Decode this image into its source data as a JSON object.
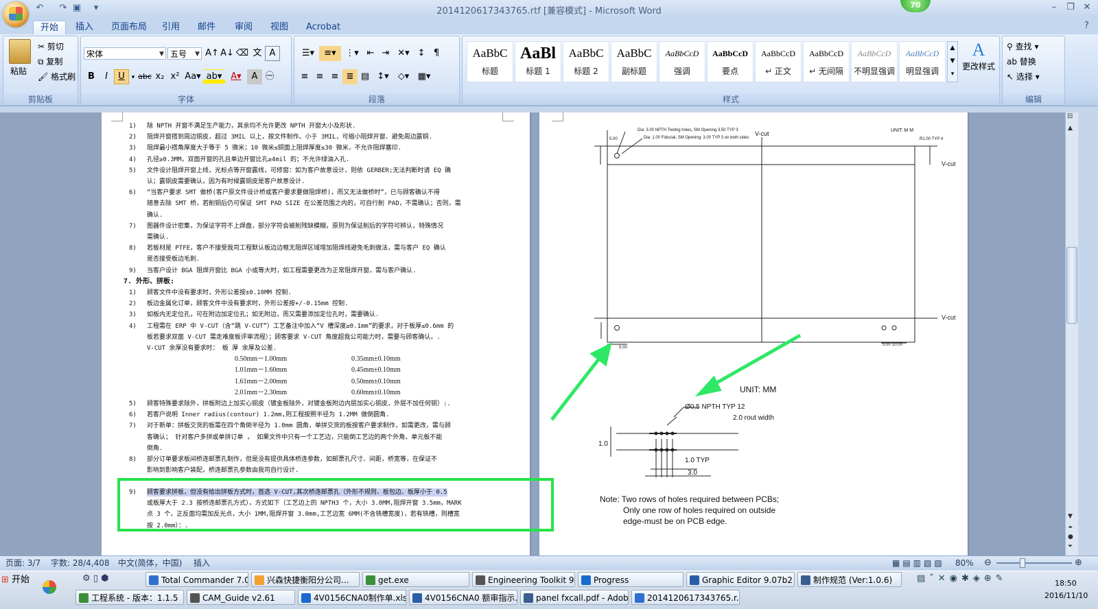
{
  "window": {
    "title": "2014120617343765.rtf [兼容模式] - Microsoft Word",
    "badge": "70"
  },
  "tabs": [
    "开始",
    "插入",
    "页面布局",
    "引用",
    "邮件",
    "审阅",
    "视图",
    "Acrobat"
  ],
  "ribbon": {
    "clipboard": {
      "label": "剪贴板",
      "paste": "粘贴",
      "cut": "剪切",
      "copy": "复制",
      "format_painter": "格式刷"
    },
    "font": {
      "label": "字体",
      "font_name": "宋体",
      "font_size": "五号"
    },
    "paragraph": {
      "label": "段落"
    },
    "styles": {
      "label": "样式",
      "change_styles": "更改样式",
      "items": [
        {
          "preview": "AaBbC",
          "name": "标题"
        },
        {
          "preview": "AaBl",
          "name": "标题 1"
        },
        {
          "preview": "AaBbC",
          "name": "标题 2"
        },
        {
          "preview": "AaBbC",
          "name": "副标题"
        },
        {
          "preview": "AaBbCcD",
          "name": "强调"
        },
        {
          "preview": "AaBbCcD",
          "name": "要点"
        },
        {
          "preview": "AaBbCcD",
          "name": "↵ 正文"
        },
        {
          "preview": "AaBbCcD",
          "name": "↵ 无间隔"
        },
        {
          "preview": "AaBbCcD",
          "name": "不明显强调"
        },
        {
          "preview": "AaBbCcD",
          "name": "明显强调"
        }
      ]
    },
    "editing": {
      "label": "编辑",
      "find": "查找",
      "replace": "替换",
      "select": "选择"
    }
  },
  "doc_left": {
    "lines": [
      {
        "n": "1)",
        "t": "除 NPTH 开窗不满足生产能力，其余均不允许更改 NPTH 开窗大小及形状."
      },
      {
        "n": "2)",
        "t": "阻焊开窗搭到周边铜皮，超过 3MIL 以上，按文件制作。小于 3MIL，可缩小阻焊开窗、避免周边露铜."
      },
      {
        "n": "3)",
        "t": "阻焊最小搭角厚度大于等于 5 微米；10 微米≤铜面上阻焊厚度≤30 微米，不允许阻焊塞印."
      },
      {
        "n": "4)",
        "t": "孔径≥0.3MM，双面开窗的孔且单边开窗比孔≥4mil 的；不允许绿油入孔."
      },
      {
        "n": "5)",
        "t": "文件设计阻焊开窗上线，光标点等开窗露线，可修窗：如为客户故意设计，则依 GERBER;无法判断时请 EQ 确"
      },
      {
        "n": "",
        "t": "认；露铜皮需要确认，因为有时候露铜皮是客户故意设计."
      },
      {
        "n": "6)",
        "t": "“当客户要求 SMT 做桥(客户原文件设计桥或客户要求要做阻焊桥)，而又无法做桥时”，已与顾客确认不得"
      },
      {
        "n": "",
        "t": "随意去除 SMT 桥，若削铜后仍可保证 SMT PAD SIZE 在公差范围之内的，可自行削 PAD，不需确认；否则，需"
      },
      {
        "n": "",
        "t": "确认."
      },
      {
        "n": "7)",
        "t": "图器件设计密集，为保证字符不上焊盘，部分字符会被削残缺模糊，原则为保证削后的字符可辨认，特殊情况"
      },
      {
        "n": "",
        "t": "需确认."
      },
      {
        "n": "8)",
        "t": "若板材是 PTFE，客户不接受我司工程默认板边边框无阻焊区域增加阻焊线避免毛刺做法，需与客户 EQ 确认"
      },
      {
        "n": "",
        "t": "是否接受板边毛刺."
      },
      {
        "n": "9)",
        "t": "当客户设计 BGA 阻焊开窗比 BGA 小或等大时，如工程需要更改为正常阻焊开窗，需与客户确认."
      }
    ],
    "heading": "7.   外形、拼板:",
    "lines2": [
      {
        "n": "1)",
        "t": "顾客文件中没有要求时，外形公差按±0.10MM 控制."
      },
      {
        "n": "2)",
        "t": "板边金属化订单，顾客文件中没有要求时，外形公差按+/-0.15mm 控制."
      },
      {
        "n": "3)",
        "t": "如板内无定位孔，可在附边加定位孔；如无附边，而又需要添加定位孔时，需要确认."
      },
      {
        "n": "4)",
        "t": "工程需在 ERP 中 V-CUT（含“跳 V-CUT”）工艺备注中加入“V 槽深度≥0.1mm”的要求，对于板厚≤0.6mm 的"
      },
      {
        "n": "",
        "t": "板若要求双面 V-CUT 需走难度板评审流程）；顾客要求 V-CUT 角度超我公司能力时，需要与顾客确认。."
      },
      {
        "n": "",
        "t": "V-CUT 余厚没有要求时：         板  厚                       余厚及公差."
      }
    ],
    "table": [
      [
        "0.50mm－1.00mm",
        "0.35mm±0.10mm"
      ],
      [
        "1.01mm－1.60mm",
        "0.45mm±0.10mm"
      ],
      [
        "1.61mm－2.00mm",
        "0.50mm±0.10mm"
      ],
      [
        "2.01mm－2.30mm",
        "0.60mm±0.10mm"
      ]
    ],
    "lines3": [
      {
        "n": "5)",
        "t": "顾客特殊要求除外，拼板附边上加实心铜皮（镀金板除外，对镀金板附边内层加实心铜皮，外层不加任何铜）:."
      },
      {
        "n": "6)",
        "t": "若客户说明 Inner radius(contour) 1.2mm,则工程按照半径为 1.2MM 做倒圆角."
      },
      {
        "n": "7)",
        "t": "对于新单：拼板交货的板需在四个角倒半径为 1.0mm 圆角，单拼交货的板按客户要求制作，如需更改，需与顾"
      },
      {
        "n": "",
        "t": "客确认；  针对客户多拼或单拼订单 ， 如果文件中只有一个工艺边，只能倒工艺边的两个外角，单元板不能"
      },
      {
        "n": "",
        "t": "倒角."
      },
      {
        "n": "8)",
        "t": "部分订单要求板间桥连邮票孔制作，但是没有提供具体桥连参数，如邮票孔尺寸、间距，桥宽等，在保证不"
      },
      {
        "n": "",
        "t": "影响到影响客户装配，桥连邮票孔参数由我司自行设计."
      }
    ],
    "highlight_lines": [
      {
        "n": "9)",
        "t": "顾客要求拼板，但没有给出拼板方式时，首选 V-CUT,其次桥连邮票孔（外形不规则、板包边、板厚小于 0.5"
      },
      {
        "n": "",
        "t": "或板厚大于 2.3 按桥连邮票孔方式），方式如下（工艺边上的 NPTH3 个，大小 3.0MM,阻焊开窗 3.5mm，MARK"
      },
      {
        "n": "",
        "t": "点 3 个，正反面均需加反光点，大小 1MM,阻焊开窗 3.0mm,工艺边宽 6MM(不含铣槽宽度)，若有铣槽，则槽宽"
      },
      {
        "n": "",
        "t": "按 2.0mm）：."
      }
    ]
  },
  "doc_right": {
    "dia_note_1": "Dia: 3.00 NPTH Tooling holes, SM Opening 3.50 TYP 3",
    "dia_note_2": "Dia: 1.00 Fiducial, SM Opening: 3.00 TYP 3 on both sides",
    "vcut": "V-cut",
    "unit_small": "UNIT: M M",
    "radius": "R1.00 TYP 4",
    "dim_5": "5.00",
    "dim_10": "10.00",
    "unit_big": "UNIT: MM",
    "npth": "Ø0,5 NPTH TYP 12",
    "rout": "2.0 rout width",
    "d1": "1.0",
    "d1typ": "1.0 TYP",
    "d3": "3.0",
    "note1": "Note: Two rows of holes required between PCBs;",
    "note2": "Only one row of holes required on outside",
    "note3": "edge-must be on PCB edge."
  },
  "status": {
    "page": "页面: 3/7",
    "words": "字数: 28/4,408",
    "lang": "中文(简体，中国)",
    "mode": "插入",
    "zoom": "80%"
  },
  "taskbar": {
    "start": "开始",
    "row1": [
      "Total Commander 7.0 pu...",
      "兴森快捷衡阳分公司...",
      "get.exe",
      "Engineering Toolkit 9.07...",
      "Progress",
      "Graphic Editor 9.07b2 (0...",
      "制作规范 (Ver:1.0.6)"
    ],
    "row2": [
      "工程系统 - 版本：1.1.5",
      "CAM_Guide v2.61",
      "4V0156CNA0制作单.xls",
      "4V0156CNA0 额审指示...",
      "panel fxcall.pdf - Adobe...",
      "2014120617343765.r..."
    ],
    "time": "18:50",
    "date": "2016/11/10"
  },
  "colors": {
    "highlight_box": "#26e24a",
    "arrow": "#2ee866",
    "ribbon_text": "#15428b"
  }
}
